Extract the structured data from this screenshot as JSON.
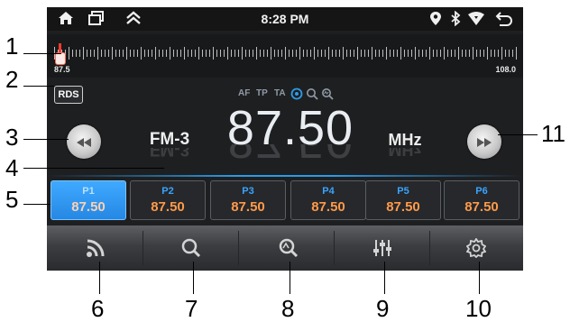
{
  "status_bar": {
    "time": "8:28 PM",
    "left_icons": [
      "home-icon",
      "recent-apps-icon",
      "chevron-up-icon"
    ],
    "right_icons": [
      "location-icon",
      "bluetooth-icon",
      "wifi-icon",
      "back-icon"
    ]
  },
  "tuner": {
    "min_label": "87.5",
    "max_label": "108.0",
    "needle_value": 87.5
  },
  "rds_button": "RDS",
  "flags": [
    "AF",
    "TP",
    "TA"
  ],
  "flag_icons": [
    "stereo-icon",
    "search-icon",
    "scan-icon"
  ],
  "station": {
    "band": "FM-3",
    "frequency": "87.50",
    "unit": "MHz"
  },
  "seek": {
    "prev_icon": "rewind-icon",
    "next_icon": "fast-forward-icon"
  },
  "presets": [
    {
      "label": "P1",
      "freq": "87.50",
      "active": true
    },
    {
      "label": "P2",
      "freq": "87.50",
      "active": false
    },
    {
      "label": "P3",
      "freq": "87.50",
      "active": false
    },
    {
      "label": "P4",
      "freq": "87.50",
      "active": false
    },
    {
      "label": "P5",
      "freq": "87.50",
      "active": false
    },
    {
      "label": "P6",
      "freq": "87.50",
      "active": false
    }
  ],
  "bottom_bar": [
    "signal-icon",
    "search-icon",
    "scan-icon",
    "equalizer-icon",
    "settings-icon"
  ],
  "callouts": [
    "1",
    "2",
    "3",
    "4",
    "5",
    "6",
    "7",
    "8",
    "9",
    "10",
    "11"
  ],
  "colors": {
    "accent_blue": "#2d9be6",
    "preset_freq": "#ff9a4a",
    "needle": "#ff3a2e"
  }
}
